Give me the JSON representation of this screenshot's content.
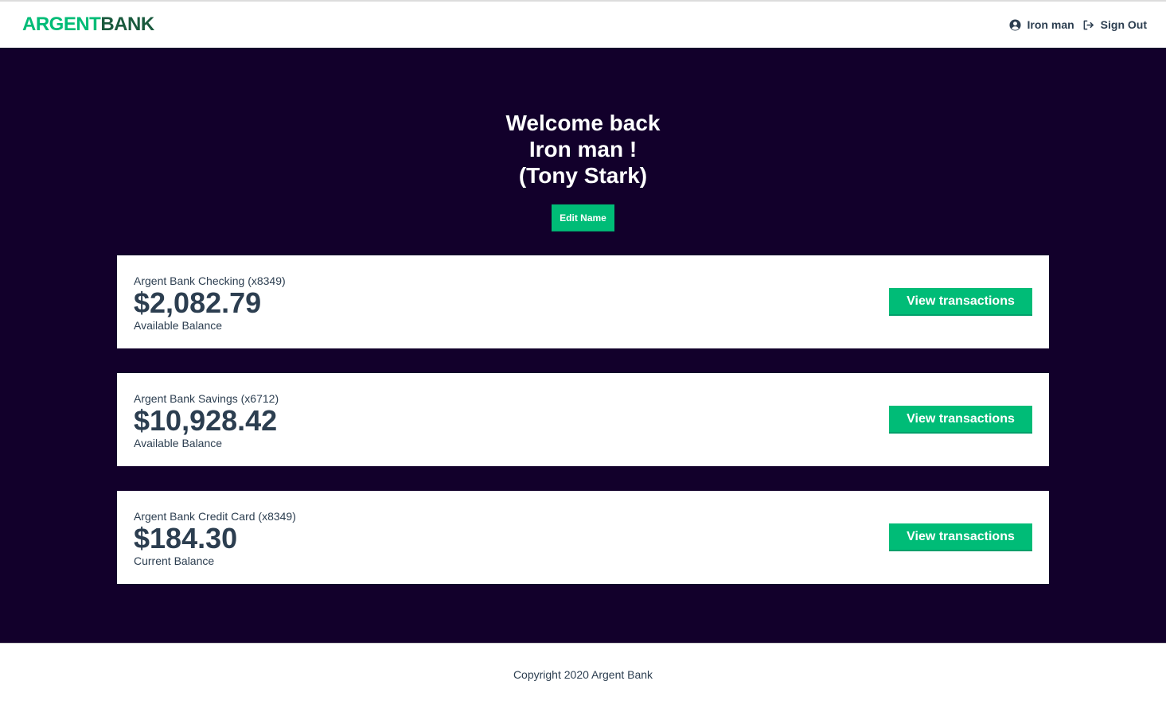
{
  "header": {
    "logo_light": "ARGENT",
    "logo_dark": "BANK",
    "user_name": "Iron man",
    "sign_out_label": "Sign Out"
  },
  "welcome": {
    "line1": "Welcome back",
    "line2": "Iron man !",
    "line3": "(Tony Stark)",
    "edit_button_label": "Edit Name"
  },
  "accounts": [
    {
      "title": "Argent Bank Checking (x8349)",
      "amount": "$2,082.79",
      "description": "Available Balance",
      "button_label": "View transactions"
    },
    {
      "title": "Argent Bank Savings (x6712)",
      "amount": "$10,928.42",
      "description": "Available Balance",
      "button_label": "View transactions"
    },
    {
      "title": "Argent Bank Credit Card (x8349)",
      "amount": "$184.30",
      "description": "Current Balance",
      "button_label": "View transactions"
    }
  ],
  "footer": {
    "copyright": "Copyright 2020 Argent Bank"
  },
  "colors": {
    "brand_green": "#00bc77",
    "brand_dark_green": "#1a5a3e",
    "main_background": "#12002b",
    "text_dark": "#2c3e50"
  },
  "icons": {
    "user": "user-circle-icon",
    "sign_out": "sign-out-icon"
  }
}
